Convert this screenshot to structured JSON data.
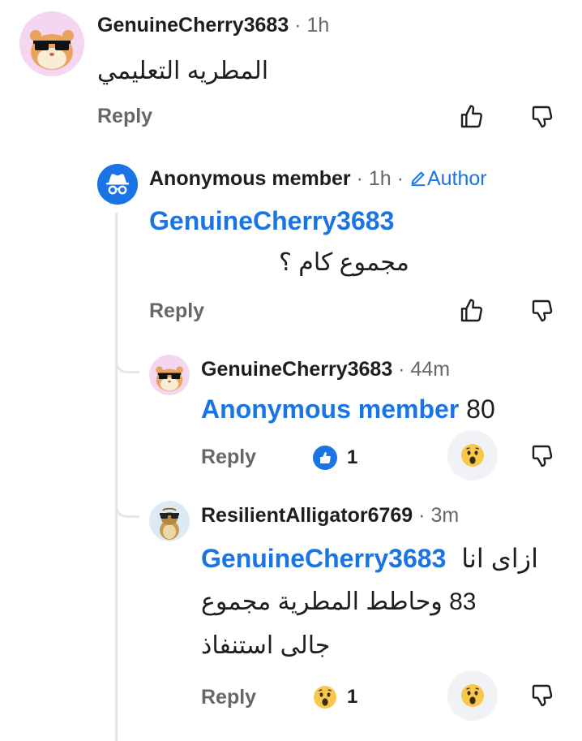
{
  "comments": [
    {
      "author": "GenuineCherry3683",
      "time": "1h",
      "text": "المطريه التعليمي",
      "reply_label": "Reply"
    },
    {
      "author": "Anonymous member",
      "time": "1h",
      "badge": "Author",
      "mention": "GenuineCherry3683",
      "text": "مجموع كام ؟",
      "reply_label": "Reply"
    },
    {
      "author": "GenuineCherry3683",
      "time": "44m",
      "mention": "Anonymous member",
      "text": "80",
      "reply_label": "Reply",
      "reaction_count": "1"
    },
    {
      "author": "ResilientAlligator6769",
      "time": "3m",
      "line1_prefix": "ازاى انا",
      "mention": "GenuineCherry3683",
      "line2": "83 وحاطط المطرية مجموع",
      "line3": "جالى استنفاذ",
      "reply_label": "Reply",
      "reaction_count": "1"
    }
  ],
  "separator": "·",
  "icons": [
    "hamster-sunglasses-avatar",
    "incognito-avatar",
    "alligator-avatar",
    "thumbs-up-icon",
    "thumbs-down-icon",
    "pencil-icon",
    "like-reaction-icon",
    "wow-reaction-icon"
  ],
  "colors": {
    "link": "#1b74e4",
    "meta": "#65676b",
    "incognito": "#1b74e4"
  }
}
